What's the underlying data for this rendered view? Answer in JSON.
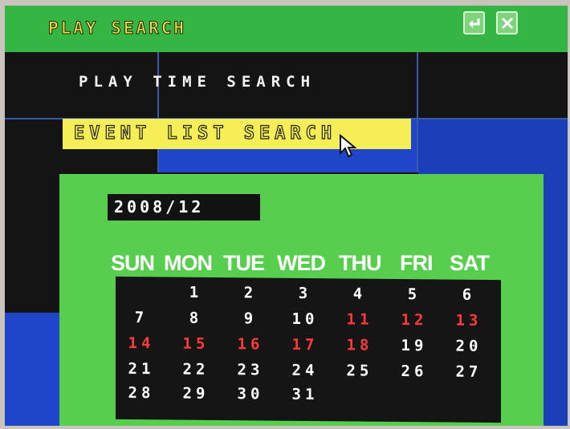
{
  "window": {
    "title": "PLAY SEARCH",
    "enter_icon": "return-arrow-icon",
    "close_icon": "close-x-icon"
  },
  "menu": {
    "play_time_search": "PLAY TIME SEARCH",
    "event_list_search": "EVENT LIST SEARCH"
  },
  "calendar": {
    "month_label": "2008/12",
    "day_names": [
      "SUN",
      "MON",
      "TUE",
      "WED",
      "THU",
      "FRI",
      "SAT"
    ],
    "weeks": [
      [
        "",
        "1",
        "2",
        "3",
        "4",
        "5",
        "6"
      ],
      [
        "7",
        "8",
        "9",
        "10",
        "11",
        "12",
        "13"
      ],
      [
        "14",
        "15",
        "16",
        "17",
        "18",
        "19",
        "20"
      ],
      [
        "21",
        "22",
        "23",
        "24",
        "25",
        "26",
        "27"
      ],
      [
        "28",
        "29",
        "30",
        "31",
        "",
        "",
        ""
      ]
    ],
    "event_days": [
      "11",
      "12",
      "13",
      "14",
      "15",
      "16",
      "17",
      "18"
    ]
  },
  "colors": {
    "title_bar": "#34b544",
    "title_text": "#f2e24a",
    "highlight": "#f6ee57",
    "calendar_panel": "#58ce4f",
    "event_day": "#ff3a3a",
    "tile_blue": "#1f45c9"
  }
}
